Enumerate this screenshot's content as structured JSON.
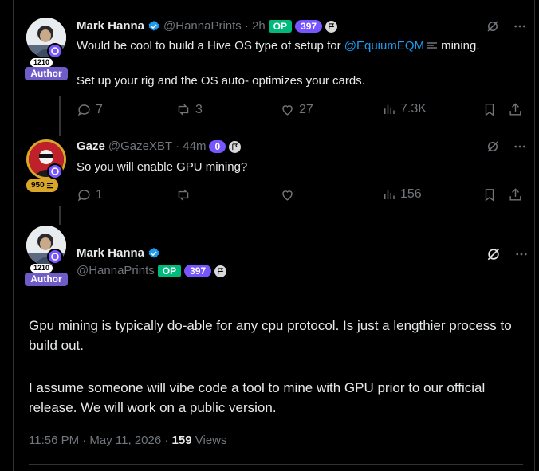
{
  "tweet1": {
    "name": "Mark Hanna",
    "handle": "@HannaPrints",
    "time": "· 2h",
    "op_label": "OP",
    "level": "397",
    "avatar_count": "1210",
    "author_label": "Author",
    "text_before_link": "Would be cool to build a Hive OS type of setup for ",
    "link_text": "@EquiumEQM",
    "text_after_link": " mining.",
    "text_line2": "Set up your rig and the OS auto- optimizes your cards.",
    "replies": "7",
    "reposts": "3",
    "likes": "27",
    "views": "7.3K"
  },
  "tweet2": {
    "name": "Gaze",
    "handle": "@GazeXBT",
    "time": "· 44m",
    "level": "0",
    "gold_badge": "950",
    "text": "So you will enable GPU mining?",
    "replies": "1",
    "reposts": "",
    "likes": "",
    "views": "156"
  },
  "tweet3": {
    "name": "Mark Hanna",
    "handle": "@HannaPrints",
    "op_label": "OP",
    "level": "397",
    "avatar_count": "1210",
    "author_label": "Author",
    "para1": "Gpu mining is typically do-able for any cpu protocol. Is just a lengthier process to build out.",
    "para2": "I assume someone will vibe code a tool to mine with GPU prior to our official release. We will work on a public version.",
    "timestamp": "11:56 PM · May 11, 2026 ·",
    "views_count": "159",
    "views_label": "Views"
  },
  "colors": {
    "background": "#000000",
    "text": "#e7e9ea",
    "muted": "#71767b",
    "link": "#1d9bf0",
    "op": "#00ba7c",
    "level": "#7856ff",
    "author": "#6f5cc8",
    "gold": "#d8a629"
  },
  "icons": [
    "verified-badge-icon",
    "flag-icon",
    "grok-icon",
    "more-icon",
    "reply-icon",
    "repost-icon",
    "like-icon",
    "views-icon",
    "bookmark-icon",
    "share-icon",
    "equium-icon"
  ]
}
